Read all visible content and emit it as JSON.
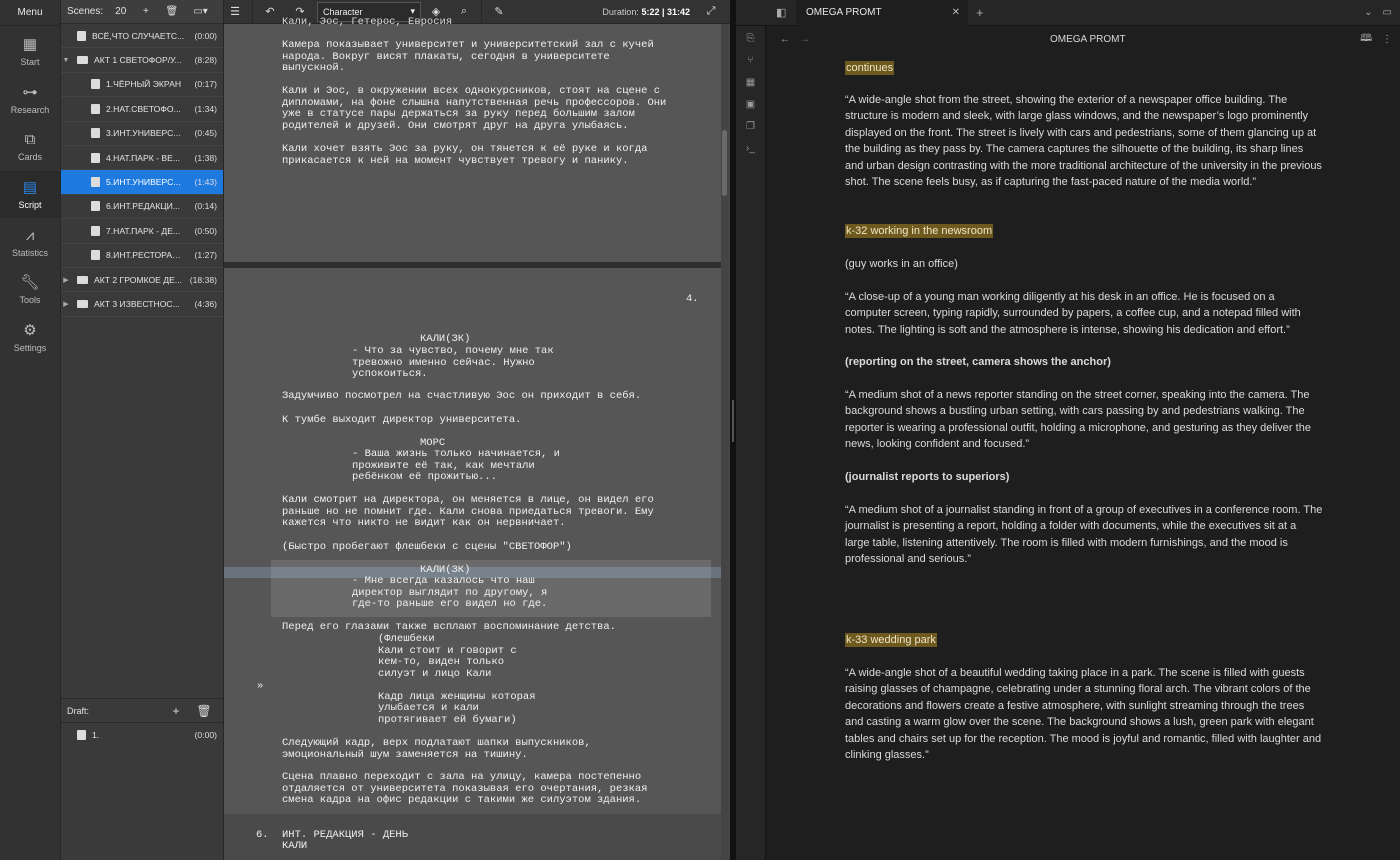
{
  "left_app": {
    "menu": "Menu",
    "rail": [
      {
        "label": "Start",
        "icon": "grid-icon"
      },
      {
        "label": "Research",
        "icon": "hierarchy-icon"
      },
      {
        "label": "Cards",
        "icon": "cards-icon"
      },
      {
        "label": "Script",
        "icon": "document-icon"
      },
      {
        "label": "Statistics",
        "icon": "chart-icon"
      },
      {
        "label": "Tools",
        "icon": "wrench-icon"
      },
      {
        "label": "Settings",
        "icon": "gear-icon"
      }
    ],
    "scenes_panel": {
      "label": "Scenes:",
      "count": "20",
      "rows": [
        {
          "name": "ВСЁ,ЧТО СЛУЧАЕТС...",
          "duration": "(0:00)"
        },
        {
          "name": "АКТ 1 СВЕТОФОР/У...",
          "duration": "(8:28)"
        },
        {
          "name": "1.ЧЁРНЫЙ ЭКРАН",
          "duration": "(0:17)"
        },
        {
          "name": "2.НАТ.СВЕТОФО...",
          "duration": "(1:34)"
        },
        {
          "name": "3.ИНТ.УНИВЕРС...",
          "duration": "(0:45)"
        },
        {
          "name": "4.НАТ.ПАРК - ВЕ...",
          "duration": "(1:38)"
        },
        {
          "name": "5.ИНТ.УНИВЕРС...",
          "duration": "(1:43)"
        },
        {
          "name": "6.ИНТ.РЕДАКЦИ...",
          "duration": "(0:14)"
        },
        {
          "name": "7.НАТ.ПАРК - ДЕ...",
          "duration": "(0:50)"
        },
        {
          "name": "8.ИНТ.РЕСТОРАН...",
          "duration": "(1:27)"
        },
        {
          "name": "АКТ 2 ГРОМКОЕ ДЕ...",
          "duration": "(18:38)"
        },
        {
          "name": "АКТ 3 ИЗВЕСТНОС...",
          "duration": "(4:36)"
        }
      ],
      "draft_label": "Draft:",
      "draft_rows": [
        {
          "name": "1.",
          "duration": "(0:00)"
        }
      ]
    },
    "toolbar": {
      "element_select": "Character",
      "duration_label": "Duration:",
      "duration_value": "5:22 | 31:42"
    },
    "script": {
      "top_cut": "Кали, Эос, Гетерос, Евросия",
      "p1": "Камера показывает университет и университетский зал с кучей\nнарода. Вокруг висят плакаты, сегодня в университете\nвыпускной.",
      "p2": "Кали и Эос, в окружении всех однокурсников, стоят на сцене с\nдипломами, на фоне слышна напутственная речь профессоров. Они\nуже в статусе пары держаться за руку перед большим залом\nродителей и друзей. Они смотрят друг на друга улыбаясь.",
      "p3": "Кали хочет взять Эос за руку, он тянется к её руке и когда\nприкасается к ней на момент чувствует тревогу и панику.",
      "page_num": "4.",
      "char1": "КАЛИ(ЗК)",
      "dlg1": "- Что за чувство, почему мне так\nтревожно именно сейчас. Нужно\nуспокоиться.",
      "a1": "Задумчиво посмотрел на счастливую Эос он приходит в себя.",
      "a2": "К тумбе выходит директор университета.",
      "char2": "МОРС",
      "dlg2": "- Ваша жизнь только начинается, и\nпроживите её так, как мечтали\nребёнком её прожитью...",
      "a3": "Кали смотрит на директора, он меняется в лице, он видел его\nраньше но не помнит где. Кали снова приедаться тревоги. Ему\nкажется что никто не видит как он нервничает.",
      "a4": "(Быстро пробегают флешбеки с сцены \"СВЕТОФОР\")",
      "char3": "КАЛИ(ЗК)",
      "dlg3": "- Мне всегда казалось что наш\nдиректор выглядит по другому, я\nгде-то раньше его видел но где.",
      "a5": "Перед его глазами также всплают воспоминание детства.",
      "paren": "(Флешбеки\nКали стоит и говорит с\nкем-то, виден только\nсилуэт и лицо Кали\n\nКадр лица женщины которая\nулыбается и кали\nпротягивает ей бумаги)",
      "margin_mark": "»",
      "a6": "Следующий кадр, верх подлатают шапки выпускников,\nэмоциональный шум заменяется на тишину.",
      "a7": "Сцена плавно переходит с зала на улицу, камера постепенно\nотдаляется от университета показывая его очертания, резкая\nсмена кадра на офис редакции с такими же силуэтом здания.",
      "scene6_num": "6.",
      "scene6_head": "ИНТ. РЕДАКЦИЯ - ДЕНЬ",
      "scene6_next": "КАЛИ"
    }
  },
  "right_app": {
    "tab_title": "OMEGA PROMT",
    "doc_title": "OMEGA PROMT",
    "blocks": {
      "continues": "continues",
      "q1": "“A wide-angle shot from the street, showing the exterior of a newspaper office building. The structure is modern and sleek, with large glass windows, and the newspaper’s logo prominently displayed on the front. The street is lively with cars and pedestrians, some of them glancing up at the building as they pass by. The camera captures the silhouette of the building, its sharp lines and urban design contrasting with the more traditional architecture of the university in the previous shot. The scene feels busy, as if capturing the fast-paced nature of the media world.”",
      "k32": "k-32  working in the newsroom",
      "k32_sub": "(guy works in an office)",
      "q2": "“A close-up of a young man working diligently at his desk in an office. He is focused on a computer screen, typing rapidly, surrounded by papers, a coffee cup, and a notepad filled with notes. The lighting is soft and the atmosphere is intense, showing his dedication and effort.”",
      "h1": "(reporting on the street, camera shows the anchor)",
      "q3": "“A medium shot of a news reporter standing on the street corner, speaking into the camera. The background shows a bustling urban setting, with cars passing by and pedestrians walking. The reporter is wearing a professional outfit, holding a microphone, and gesturing as they deliver the news, looking confident and focused.”",
      "h2": "(journalist reports to superiors)",
      "q4": "“A medium shot of a journalist standing in front of a group of executives in a conference room. The journalist is presenting a report, holding a folder with documents, while the executives sit at a large table, listening attentively. The room is filled with modern furnishings, and the mood is professional and serious.”",
      "k33": "k-33 wedding park",
      "q5": "“A wide-angle shot of a beautiful wedding taking place in a park. The scene is filled with guests raising glasses of champagne, celebrating under a stunning floral arch. The vibrant colors of the decorations and flowers create a festive atmosphere, with sunlight streaming through the trees and casting a warm glow over the scene. The background shows a lush, green park with elegant tables and chairs set up for the reception. The mood is joyful and romantic, filled with laughter and clinking glasses.”"
    }
  },
  "colors": {
    "selection": "#1f7ae0",
    "highlight": "#6e5a1f",
    "rail_active_icon": "#2a84e8"
  }
}
